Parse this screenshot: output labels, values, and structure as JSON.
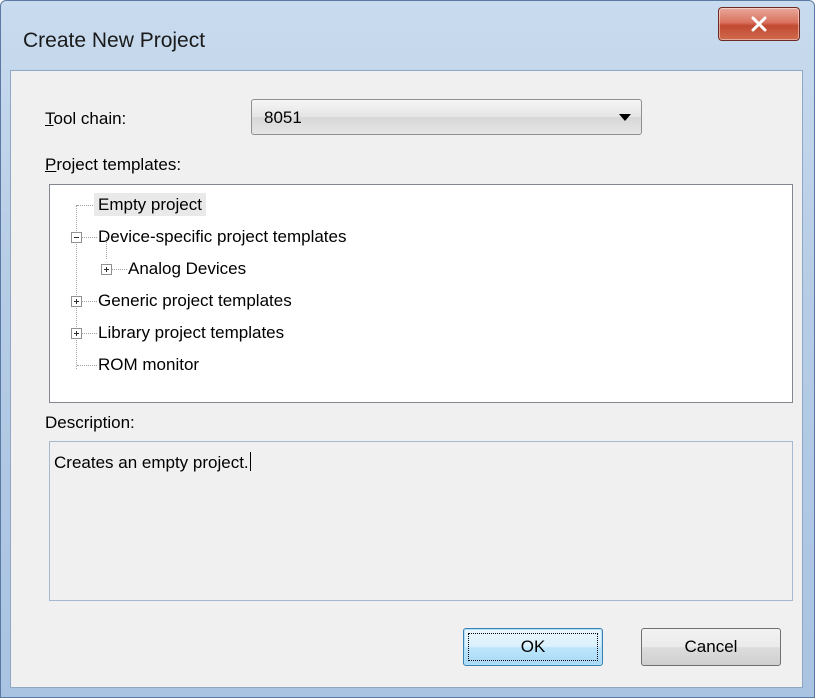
{
  "window": {
    "title": "Create New Project",
    "close_icon": "close-x-icon"
  },
  "toolchain": {
    "label_accel": "T",
    "label_rest": "ool chain:",
    "value": "8051"
  },
  "templates": {
    "label_accel": "P",
    "label_rest": "roject templates:",
    "items": [
      {
        "label": "Empty project",
        "level": 0,
        "expander": "none",
        "selected": true
      },
      {
        "label": "Device-specific project templates",
        "level": 0,
        "expander": "minus",
        "selected": false
      },
      {
        "label": "Analog Devices",
        "level": 1,
        "expander": "plus",
        "selected": false
      },
      {
        "label": "Generic project templates",
        "level": 0,
        "expander": "plus",
        "selected": false
      },
      {
        "label": "Library project templates",
        "level": 0,
        "expander": "plus",
        "selected": false
      },
      {
        "label": "ROM monitor",
        "level": 0,
        "expander": "none",
        "selected": false
      }
    ]
  },
  "description": {
    "label": "Description:",
    "text": "Creates an empty project."
  },
  "buttons": {
    "ok": "OK",
    "cancel": "Cancel"
  }
}
